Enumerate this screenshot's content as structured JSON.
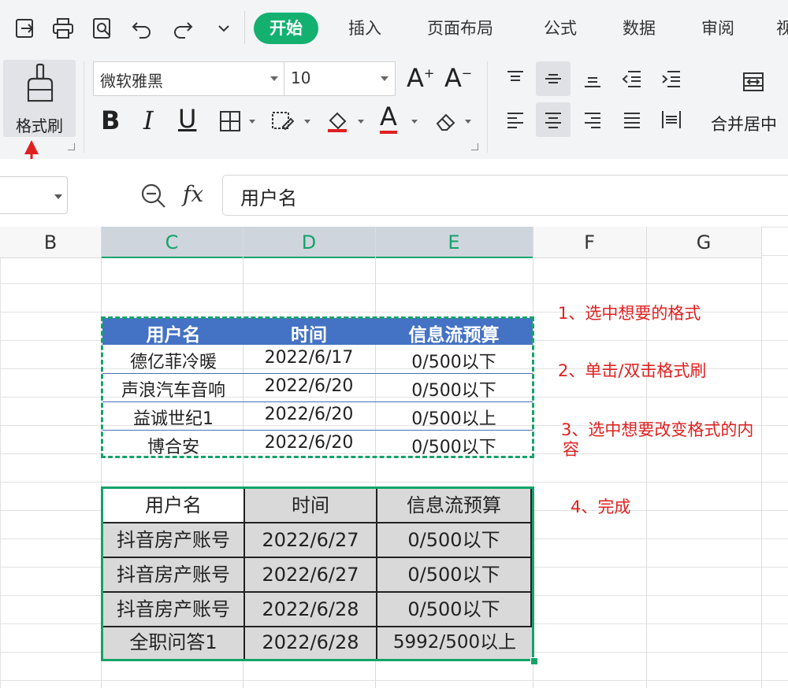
{
  "menu": {
    "tabs": [
      "开始",
      "插入",
      "页面布局",
      "公式",
      "数据",
      "审阅",
      "视"
    ],
    "active_tab": "开始"
  },
  "ribbon": {
    "format_painter_label": "格式刷",
    "font_name": "微软雅黑",
    "font_size": "10",
    "merge_center_label": "合并居中"
  },
  "formula_bar": {
    "fx_label": "fx",
    "value": "用户名"
  },
  "sheet": {
    "columns": [
      "B",
      "C",
      "D",
      "E",
      "F",
      "G"
    ],
    "selected_columns": [
      "C",
      "D",
      "E"
    ]
  },
  "table_styled": {
    "headers": [
      "用户名",
      "时间",
      "信息流预算"
    ],
    "rows": [
      [
        "德亿菲冷暖",
        "2022/6/17",
        "0/500以下"
      ],
      [
        "声浪汽车音响",
        "2022/6/20",
        "0/500以下"
      ],
      [
        "益诚世纪1",
        "2022/6/20",
        "0/500以上"
      ],
      [
        "博合安",
        "2022/6/20",
        "0/500以下"
      ]
    ]
  },
  "table_result": {
    "headers": [
      "用户名",
      "时间",
      "信息流预算"
    ],
    "rows": [
      [
        "抖音房产账号",
        "2022/6/27",
        "0/500以下"
      ],
      [
        "抖音房产账号",
        "2022/6/27",
        "0/500以下"
      ],
      [
        "抖音房产账号",
        "2022/6/28",
        "0/500以下"
      ],
      [
        "全职问答1",
        "2022/6/28",
        "5992/500以上"
      ]
    ]
  },
  "annotations": {
    "step1": "1、选中想要的格式",
    "step2": "2、单击/双击格式刷",
    "step3_line1": "3、选中想要改变格式的内",
    "step3_line2": "容",
    "step4": "4、完成"
  },
  "colors": {
    "accent": "#13b070",
    "header_blue": "#4472c4",
    "annotation_red": "#e02020"
  }
}
